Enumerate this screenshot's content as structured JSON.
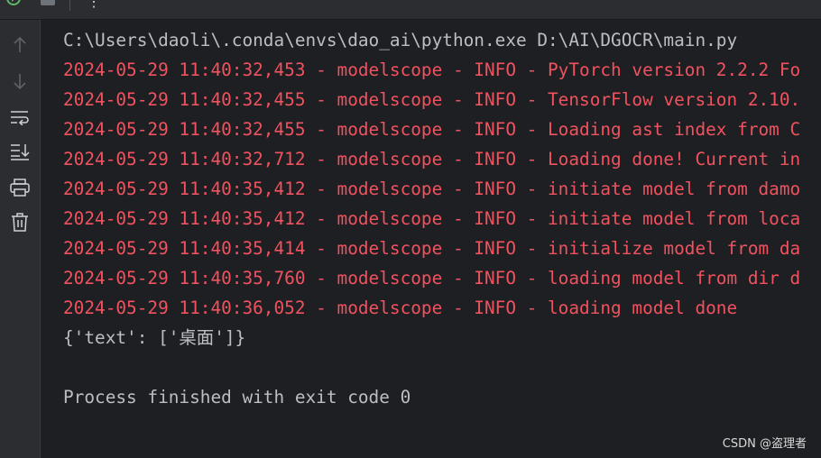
{
  "toolbar": {
    "rerun_icon": "rerun-icon",
    "stop_icon": "stop-icon",
    "more_label": "⋮"
  },
  "sidebar": {
    "items": [
      {
        "name": "scroll-up-icon"
      },
      {
        "name": "scroll-down-icon"
      },
      {
        "name": "soft-wrap-icon"
      },
      {
        "name": "scroll-to-end-icon"
      },
      {
        "name": "print-icon"
      },
      {
        "name": "clear-all-icon"
      }
    ]
  },
  "console": {
    "lines": [
      {
        "type": "cmd",
        "text": "C:\\Users\\daoli\\.conda\\envs\\dao_ai\\python.exe D:\\AI\\DGOCR\\main.py"
      },
      {
        "type": "err",
        "text": "2024-05-29 11:40:32,453 - modelscope - INFO - PyTorch version 2.2.2 Fo"
      },
      {
        "type": "err",
        "text": "2024-05-29 11:40:32,455 - modelscope - INFO - TensorFlow version 2.10."
      },
      {
        "type": "err",
        "text": "2024-05-29 11:40:32,455 - modelscope - INFO - Loading ast index from C"
      },
      {
        "type": "err",
        "text": "2024-05-29 11:40:32,712 - modelscope - INFO - Loading done! Current in"
      },
      {
        "type": "err",
        "text": "2024-05-29 11:40:35,412 - modelscope - INFO - initiate model from damo"
      },
      {
        "type": "err",
        "text": "2024-05-29 11:40:35,412 - modelscope - INFO - initiate model from loca"
      },
      {
        "type": "err",
        "text": "2024-05-29 11:40:35,414 - modelscope - INFO - initialize model from da"
      },
      {
        "type": "err",
        "text": "2024-05-29 11:40:35,760 - modelscope - INFO - loading model from dir d"
      },
      {
        "type": "err",
        "text": "2024-05-29 11:40:36,052 - modelscope - INFO - loading model done"
      },
      {
        "type": "out",
        "text": "{'text': ['桌面']}"
      },
      {
        "type": "blank",
        "text": ""
      },
      {
        "type": "out",
        "text": "Process finished with exit code 0"
      }
    ]
  },
  "watermark": "CSDN @盗理者",
  "colors": {
    "background": "#1e1f22",
    "panel": "#2b2d30",
    "stderr_text": "#f0525f",
    "stdout_text": "#bcbec4"
  }
}
